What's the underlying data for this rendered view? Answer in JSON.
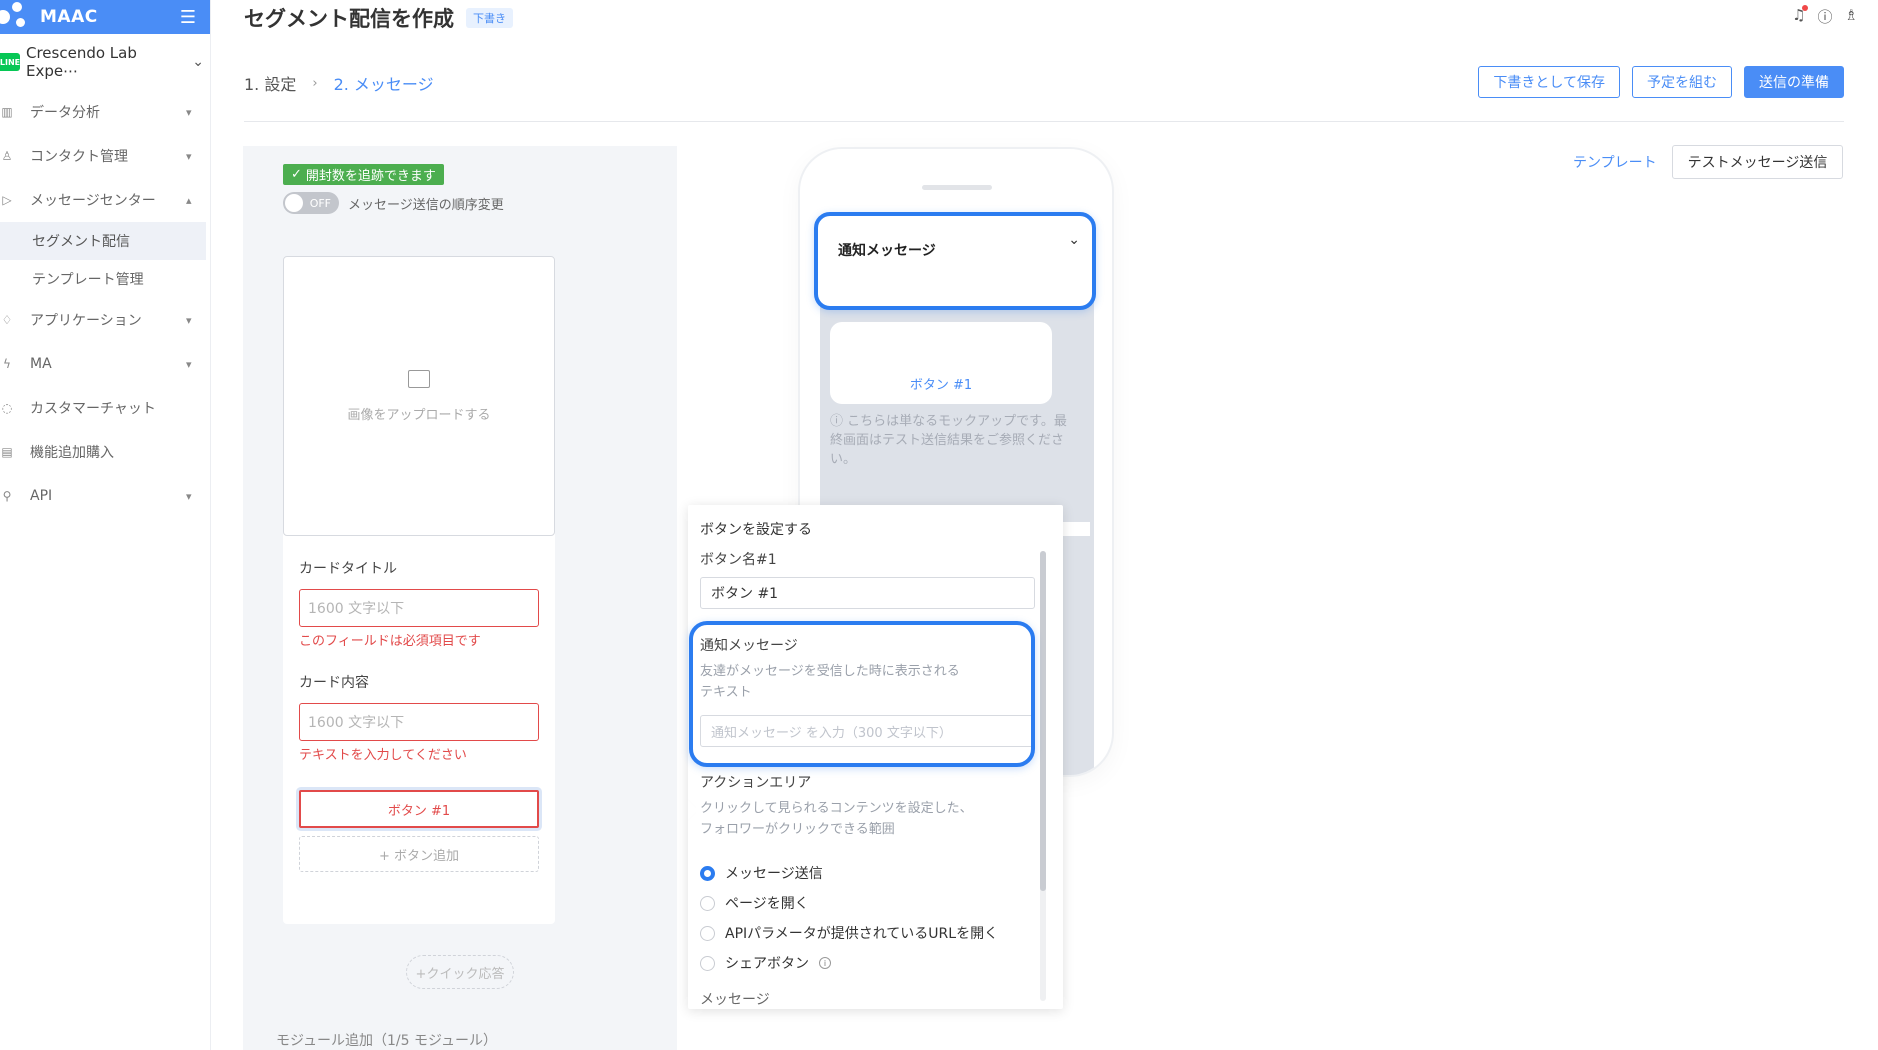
{
  "brand": {
    "name": "MAAC",
    "menu_icon": "hamburger-icon"
  },
  "account": {
    "badge": "LINE",
    "name": "Crescendo Lab Expe⋯"
  },
  "sidebar": {
    "items": [
      {
        "label": "データ分析",
        "icon": "chart-icon",
        "expandable": true
      },
      {
        "label": "コンタクト管理",
        "icon": "person-icon",
        "expandable": true
      },
      {
        "label": "メッセージセンター",
        "icon": "send-icon",
        "expandable": true,
        "expanded": true
      },
      {
        "label": "アプリケーション",
        "icon": "rocket-icon",
        "expandable": true
      },
      {
        "label": "MA",
        "icon": "bolt-icon",
        "expandable": true
      },
      {
        "label": "カスタマーチャット",
        "icon": "chat-icon",
        "expandable": false
      },
      {
        "label": "機能追加購入",
        "icon": "cart-icon",
        "expandable": false
      },
      {
        "label": "API",
        "icon": "link-icon",
        "expandable": true
      }
    ],
    "sub_items": [
      {
        "label": "セグメント配信",
        "active": true
      },
      {
        "label": "テンプレート管理",
        "active": false
      }
    ]
  },
  "header": {
    "title": "セグメント配信を作成",
    "draft_badge": "下書き",
    "steps": {
      "step1": "1. 設定",
      "separator": "›",
      "step2": "2. メッセージ"
    },
    "buttons": {
      "save_draft": "下書きとして保存",
      "schedule": "予定を組む",
      "prepare_send": "送信の準備"
    }
  },
  "editor": {
    "open_badge": "開封数を追跡できます",
    "toggle_state": "OFF",
    "toggle_label": "メッセージ送信の順序変更",
    "upload_label": "画像をアップロードする",
    "card_title_label": "カードタイトル",
    "card_title_placeholder": "1600 文字以下",
    "card_title_error": "このフィールドは必須項目です",
    "card_content_label": "カード内容",
    "card_content_placeholder": "1600 文字以下",
    "card_content_error": "テキストを入力してください",
    "button_1": "ボタン #1",
    "add_button": "+ ボタン追加",
    "quick_reply": "+クイック応答",
    "module_add": "モジュール追加（1/5 モジュール）"
  },
  "preview": {
    "notification_title": "通知メッセージ",
    "bubble_button": "ボタン #1",
    "mock_note": "こちらは単なるモックアップです。最終画面はテスト送信結果をご参照ください。",
    "template_link": "テンプレート",
    "test_send": "テストメッセージ送信"
  },
  "popover": {
    "title": "ボタンを設定する",
    "button_name_label": "ボタン名#1",
    "button_name_value": "ボタン #1",
    "notification_label": "通知メッセージ",
    "notification_help_1": "友達がメッセージを受信した時に表示される",
    "notification_help_2": "テキスト",
    "notification_placeholder": "通知メッセージ を入力（300 文字以下）",
    "action_label": "アクションエリア",
    "action_help_1": "クリックして見られるコンテンツを設定した、",
    "action_help_2": "フォロワーがクリックできる範囲",
    "options": [
      {
        "label": "メッセージ送信",
        "selected": true
      },
      {
        "label": "ページを開く",
        "selected": false
      },
      {
        "label": "APIパラメータが提供されているURLを開く",
        "selected": false
      },
      {
        "label": "シェアボタン",
        "selected": false
      }
    ],
    "cut_off": "メッセージ"
  },
  "colors": {
    "accent": "#4a8df6",
    "error": "#e24a4a",
    "success": "#4cae4f",
    "highlight": "#2b7cf0"
  }
}
